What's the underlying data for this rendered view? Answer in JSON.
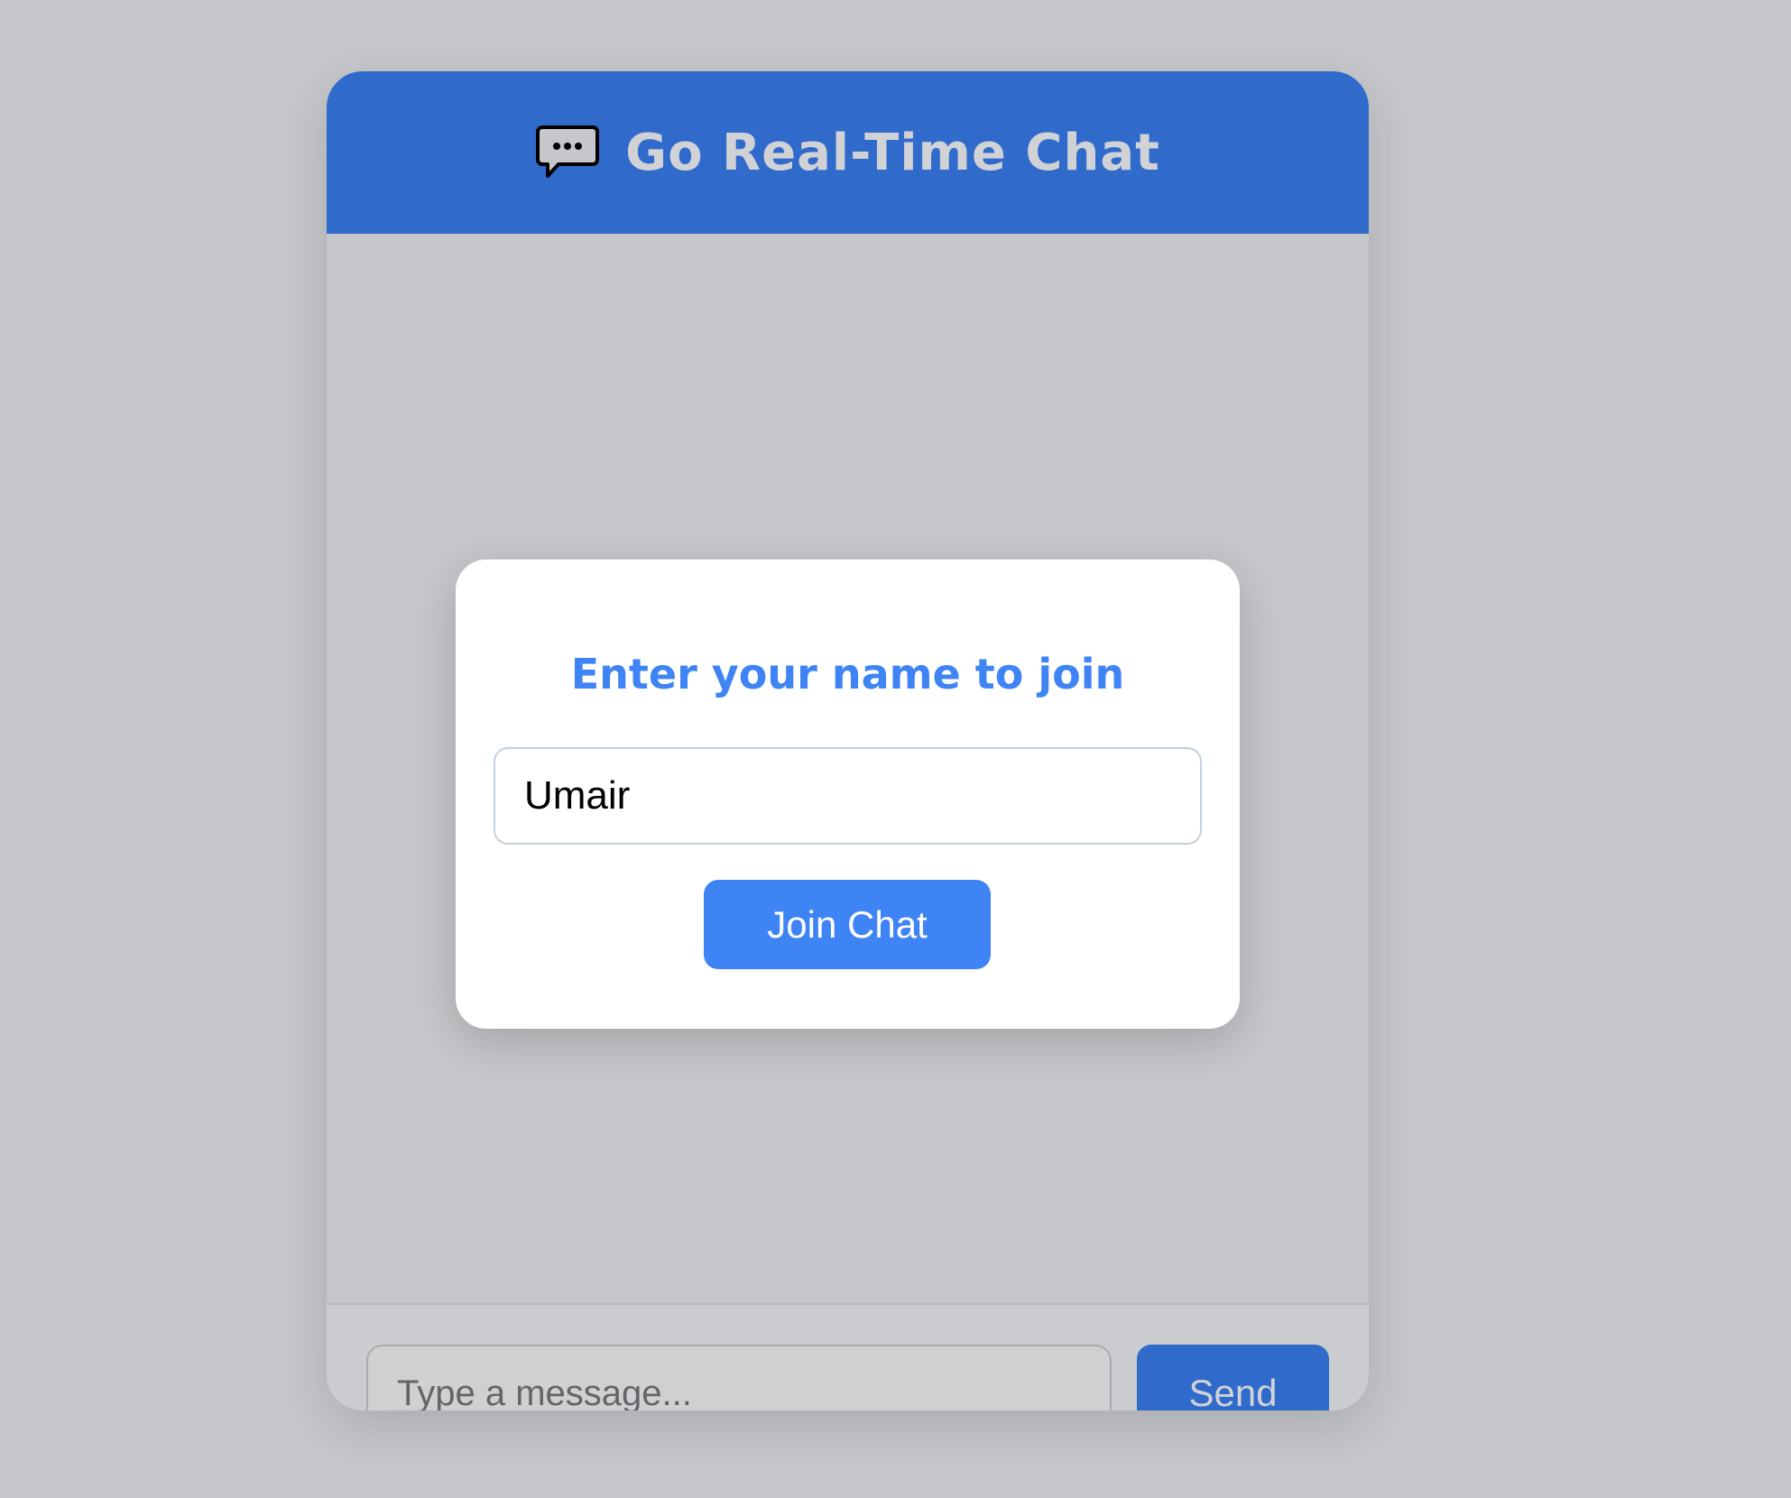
{
  "header": {
    "title": "Go Real-Time Chat",
    "icon": "speech-bubble-ellipsis-icon"
  },
  "join_modal": {
    "title": "Enter your name to join",
    "name_value": "Umair",
    "join_label": "Join Chat"
  },
  "composer": {
    "placeholder": "Type a message...",
    "value": "",
    "send_label": "Send"
  },
  "colors": {
    "header_blue": "#306bcb",
    "accent_blue": "#3f84f5",
    "overlay_gray": "#c6c7ca"
  }
}
